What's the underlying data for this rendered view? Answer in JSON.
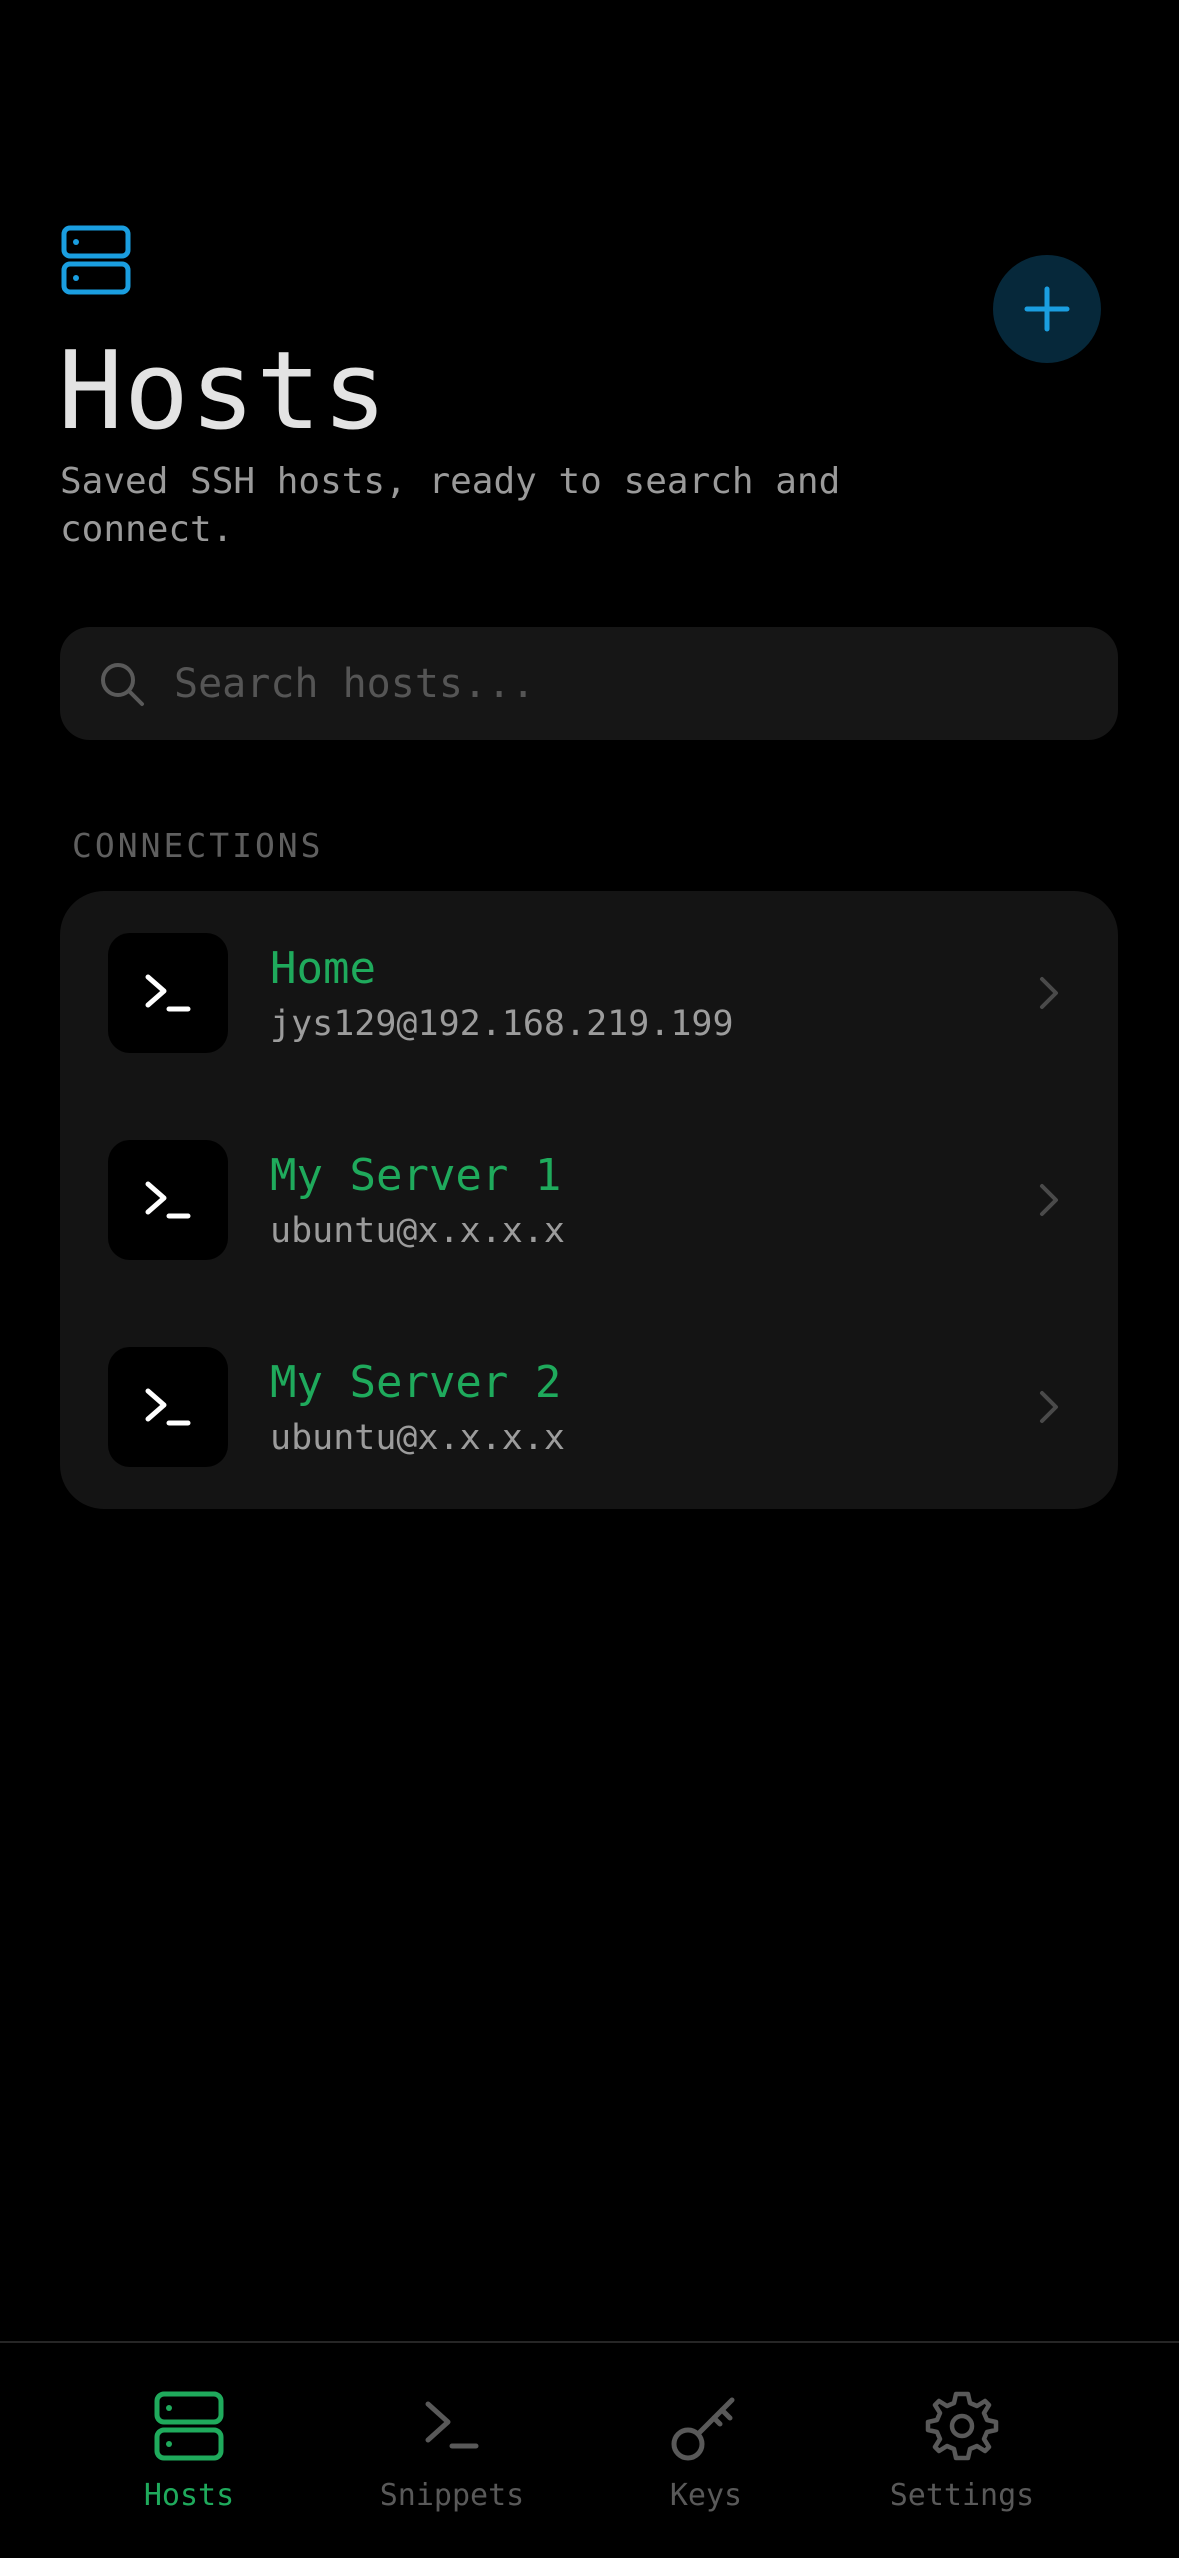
{
  "header": {
    "title": "Hosts",
    "subtitle": "Saved SSH hosts, ready to search and connect.",
    "icon": "server-icon",
    "add_button_icon": "plus-icon"
  },
  "search": {
    "placeholder": "Search hosts...",
    "value": ""
  },
  "connections": {
    "section_label": "CONNECTIONS",
    "hosts": [
      {
        "name": "Home",
        "address": "jys129@192.168.219.199",
        "icon": "terminal-icon"
      },
      {
        "name": "My Server 1",
        "address": "ubuntu@x.x.x.x",
        "icon": "terminal-icon"
      },
      {
        "name": "My Server 2",
        "address": "ubuntu@x.x.x.x",
        "icon": "terminal-icon"
      }
    ]
  },
  "tab_bar": {
    "tabs": [
      {
        "label": "Hosts",
        "icon": "server-icon",
        "active": true
      },
      {
        "label": "Snippets",
        "icon": "terminal-icon",
        "active": false
      },
      {
        "label": "Keys",
        "icon": "key-icon",
        "active": false
      },
      {
        "label": "Settings",
        "icon": "gear-icon",
        "active": false
      }
    ]
  },
  "colors": {
    "background": "#000000",
    "accent_blue": "#1a9ee0",
    "accent_green": "#1faa5c",
    "card": "#141414",
    "muted_text": "#9c9c9c"
  }
}
